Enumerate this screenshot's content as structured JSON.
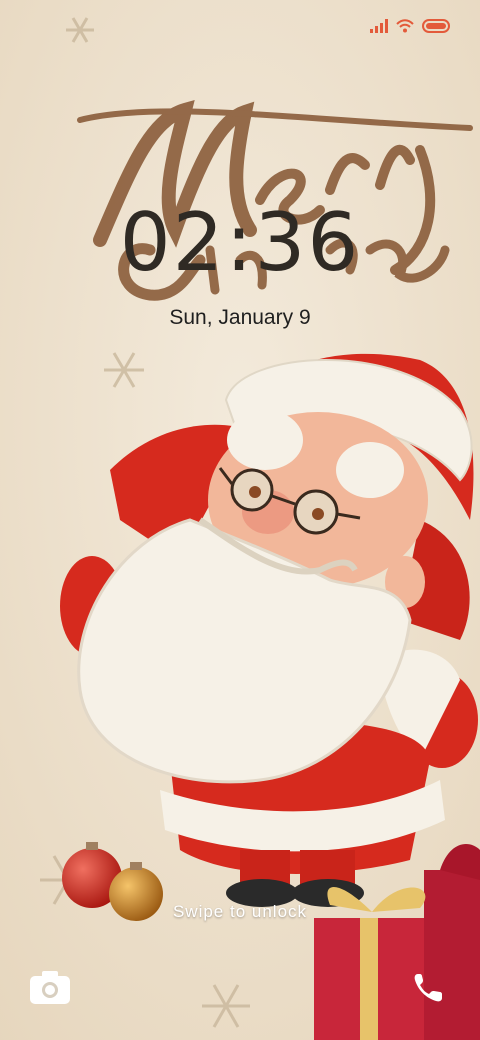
{
  "lockscreen": {
    "time": "02:36",
    "date": "Sun, January 9",
    "swipe_hint": "Swipe to unlock"
  },
  "wallpaper": {
    "greeting_line1": "Merry",
    "greeting_line2": "Christmas"
  },
  "status_bar": {
    "icons": [
      "signal-icon",
      "wifi-icon",
      "battery-icon"
    ],
    "accent": "#e35a3a"
  },
  "shortcuts": {
    "left": "camera-icon",
    "right": "phone-icon"
  },
  "colors": {
    "background": "#efe4d2",
    "santa_red": "#d62a1e",
    "lettering": "#8a5c3a"
  }
}
